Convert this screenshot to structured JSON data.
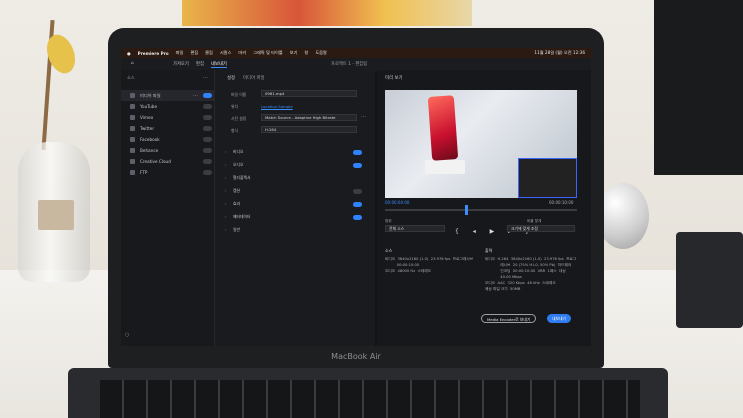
{
  "menubar": {
    "app_name": "Premiere Pro",
    "items": [
      "파일",
      "편집",
      "클립",
      "시퀀스",
      "마커",
      "그래픽 및 타이틀",
      "보기",
      "창",
      "도움말"
    ],
    "status_right": "11월 28일 (월) 오전 12:36"
  },
  "header": {
    "tabs": [
      "가져오기",
      "편집",
      "내보내기"
    ],
    "project_title": "프로젝트 1 - 편집됨"
  },
  "left_panel": {
    "title": "소스",
    "destinations": [
      {
        "label": "미디어 파일",
        "on": true
      },
      {
        "label": "YouTube",
        "on": false
      },
      {
        "label": "Vimeo",
        "on": false
      },
      {
        "label": "Twitter",
        "on": false
      },
      {
        "label": "Facebook",
        "on": false
      },
      {
        "label": "Behance",
        "on": false
      },
      {
        "label": "Creative Cloud",
        "on": false
      },
      {
        "label": "FTP",
        "on": false
      }
    ]
  },
  "middle_panel": {
    "title": "설정",
    "subtitle": "미디어 파일",
    "fields": [
      {
        "label": "파일 이름",
        "value": "0961.mp4"
      },
      {
        "label": "위치",
        "value": ""
      },
      {
        "label": "사전 설정",
        "value": "Match Source - Adaptive High Bitrate"
      },
      {
        "label": "형식",
        "value": "H.264"
      }
    ],
    "location_link": "Location-Sample",
    "sections": [
      {
        "label": "비디오",
        "on": true
      },
      {
        "label": "오디오",
        "on": true
      },
      {
        "label": "멀티플렉서",
        "on": null
      },
      {
        "label": "캡션",
        "on": false
      },
      {
        "label": "효과",
        "on": true
      },
      {
        "label": "메타데이터",
        "on": true
      },
      {
        "label": "일반",
        "on": null
      }
    ]
  },
  "right_panel": {
    "title": "미리 보기",
    "timecode_start": "00:00:04:00",
    "timecode_end": "00:00:10:00",
    "range_label": "범위",
    "range_value": "전체 소스",
    "scale_label": "비율 맞게",
    "scale_value": "크기에 맞게 조정",
    "source_heading": "소스",
    "source_text": "비디오  3840x2160 (1.0)  23.976 fps  프로그레시브\n          00:00:10:00\n오디오  48000 Hz  스테레오",
    "output_heading": "출력",
    "output_text": "비디오  H.264  3840x2160 (1.0)  23.976 fps  프로그\n             레시브  20 (75% H.L0, 50% Pb)  하드웨어\n             인코딩  00:00:10:00  VBR  1패스  대상\n             40.00 Mbps\n오디오  AAC  320 Kbps  48 kHz  스테레오\n예상 파일 크기  50MB",
    "encoder_button": "Media Encoder로 보내기",
    "export_button": "내보내기"
  },
  "laptop": {
    "brand": "MacBook Air"
  }
}
